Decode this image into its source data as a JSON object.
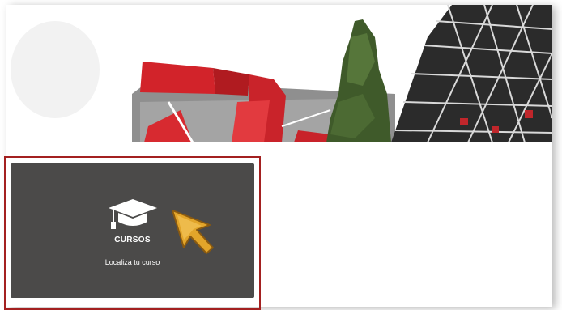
{
  "card": {
    "title": "CURSOS",
    "subtitle": "Localiza tu curso",
    "icon": "graduation-cap-icon"
  },
  "colors": {
    "card_bg": "#4b4a49",
    "outline": "#a32020",
    "sculpture_red": "#d2232a",
    "pointer_gold": "#e2a52a"
  }
}
